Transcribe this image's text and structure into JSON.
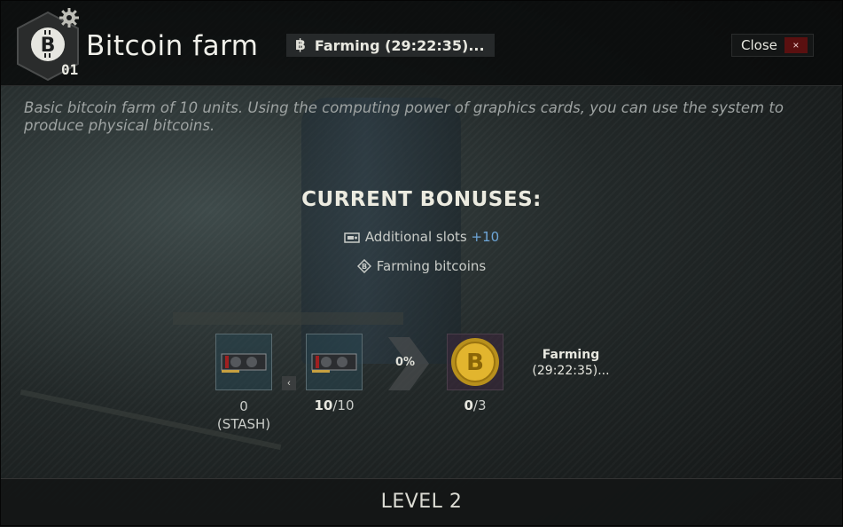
{
  "header": {
    "level_badge": "01",
    "title": "Bitcoin farm",
    "status_symbol": "฿",
    "status_text": "Farming (29:22:35)...",
    "close_label": "Close",
    "close_icon": "×"
  },
  "description": "Basic bitcoin farm of 10 units. Using the computing power of graphics cards, you can use the system to produce physical bitcoins.",
  "bonuses": {
    "title": "CURRENT BONUSES:",
    "items": [
      {
        "icon": "gpu-slot-icon",
        "label": "Additional slots",
        "value": "+10"
      },
      {
        "icon": "bitcoin-diamond-icon",
        "label": "Farming bitcoins",
        "value": ""
      }
    ]
  },
  "production": {
    "stash_count": "0",
    "stash_label": "(STASH)",
    "installed_count": "10",
    "installed_total": "/10",
    "back_arrow": "‹",
    "progress": "0%",
    "output_count": "0",
    "output_total": "/3",
    "farm_status_line1": "Farming",
    "farm_status_line2": "(29:22:35)..."
  },
  "footer": {
    "level_label": "LEVEL 2"
  }
}
